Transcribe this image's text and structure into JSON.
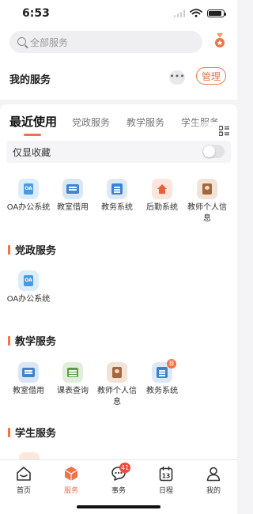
{
  "status": {
    "time": "6:53"
  },
  "search": {
    "placeholder": "全部服务"
  },
  "my_services": {
    "title": "我的服务",
    "more": "•••",
    "manage": "管理"
  },
  "tabs": [
    {
      "label": "最近使用",
      "active": true
    },
    {
      "label": "党政服务",
      "active": false
    },
    {
      "label": "教学服务",
      "active": false
    },
    {
      "label": "学生服务",
      "active": false
    }
  ],
  "favorites_toggle": {
    "label": "仅显收藏",
    "on": false
  },
  "recent_apps": [
    {
      "label": "OA办公系统",
      "icon": "oa-icon"
    },
    {
      "label": "教室借用",
      "icon": "classroom-icon"
    },
    {
      "label": "教务系统",
      "icon": "academic-system-icon"
    },
    {
      "label": "后勤系统",
      "icon": "logistics-icon"
    },
    {
      "label": "教师个人信息",
      "icon": "teacher-info-icon"
    }
  ],
  "sections": [
    {
      "title": "党政服务",
      "apps": [
        {
          "label": "OA办公系统",
          "icon": "oa-icon"
        }
      ]
    },
    {
      "title": "教学服务",
      "apps": [
        {
          "label": "教室借用",
          "icon": "classroom-icon"
        },
        {
          "label": "课表查询",
          "icon": "timetable-icon"
        },
        {
          "label": "教师个人信息",
          "icon": "teacher-info-icon"
        },
        {
          "label": "教务系统",
          "icon": "academic-system-icon",
          "badge": "荐"
        }
      ]
    },
    {
      "title": "学生服务",
      "apps": []
    }
  ],
  "tabbar": [
    {
      "label": "首页",
      "icon": "home-icon",
      "active": false
    },
    {
      "label": "服务",
      "icon": "service-box-icon",
      "active": true
    },
    {
      "label": "事务",
      "icon": "message-icon",
      "active": false,
      "badge": "41"
    },
    {
      "label": "日程",
      "icon": "calendar-icon",
      "active": false,
      "day": "13"
    },
    {
      "label": "我的",
      "icon": "profile-icon",
      "active": false
    }
  ],
  "colors": {
    "accent": "#f07246",
    "badge": "#ee4a3b"
  }
}
